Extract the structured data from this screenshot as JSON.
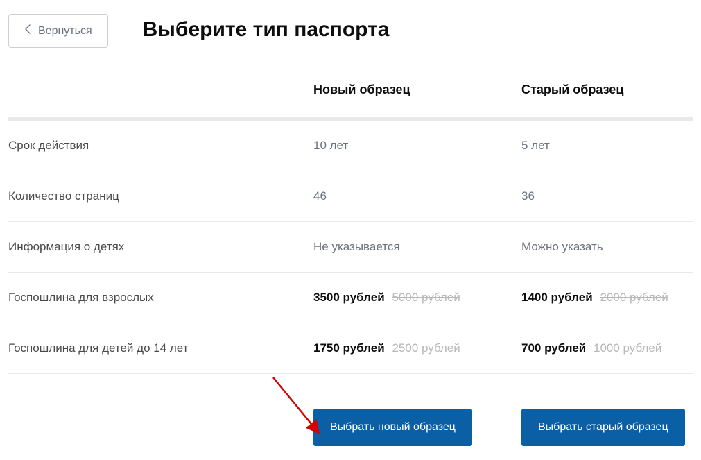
{
  "back_label": "Вернуться",
  "title": "Выберите тип паспорта",
  "columns": {
    "new": "Новый образец",
    "old": "Старый образец"
  },
  "rows": [
    {
      "label": "Срок действия",
      "new": "10 лет",
      "old": "5 лет",
      "bold": false
    },
    {
      "label": "Количество страниц",
      "new": "46",
      "old": "36",
      "bold": false
    },
    {
      "label": "Информация о детях",
      "new": "Не указывается",
      "old": "Можно указать",
      "bold": false
    },
    {
      "label": "Госпошлина для взрослых",
      "new": "3500 рублей",
      "new_strike": "5000 рублей",
      "old": "1400 рублей",
      "old_strike": "2000 рублей",
      "bold": true
    },
    {
      "label": "Госпошлина для детей до 14 лет",
      "new": "1750 рублей",
      "new_strike": "2500 рублей",
      "old": "700 рублей",
      "old_strike": "1000 рублей",
      "bold": true
    }
  ],
  "buttons": {
    "select_new": "Выбрать новый образец",
    "select_old": "Выбрать старый образец"
  }
}
